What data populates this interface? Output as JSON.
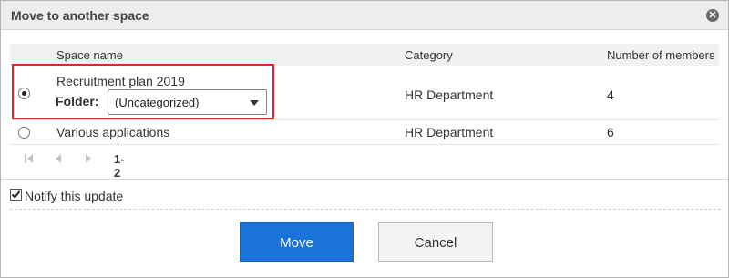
{
  "dialog": {
    "title": "Move to another space",
    "close_icon": "close-icon"
  },
  "table": {
    "headers": {
      "space_name": "Space name",
      "category": "Category",
      "members": "Number of members"
    },
    "rows": [
      {
        "selected": true,
        "name": "Recruitment plan 2019",
        "folder_label": "Folder:",
        "folder_value": "(Uncategorized)",
        "category": "HR Department",
        "members": "4"
      },
      {
        "selected": false,
        "name": "Various applications",
        "category": "HR Department",
        "members": "6"
      }
    ]
  },
  "pager": {
    "range": "1-2",
    "icons": [
      "first-page-icon",
      "prev-page-icon",
      "next-page-icon"
    ]
  },
  "notify": {
    "checked": true,
    "label": "Notify this update"
  },
  "buttons": {
    "move": "Move",
    "cancel": "Cancel"
  },
  "colors": {
    "primary": "#1a73d9",
    "highlight": "#e0262b"
  }
}
